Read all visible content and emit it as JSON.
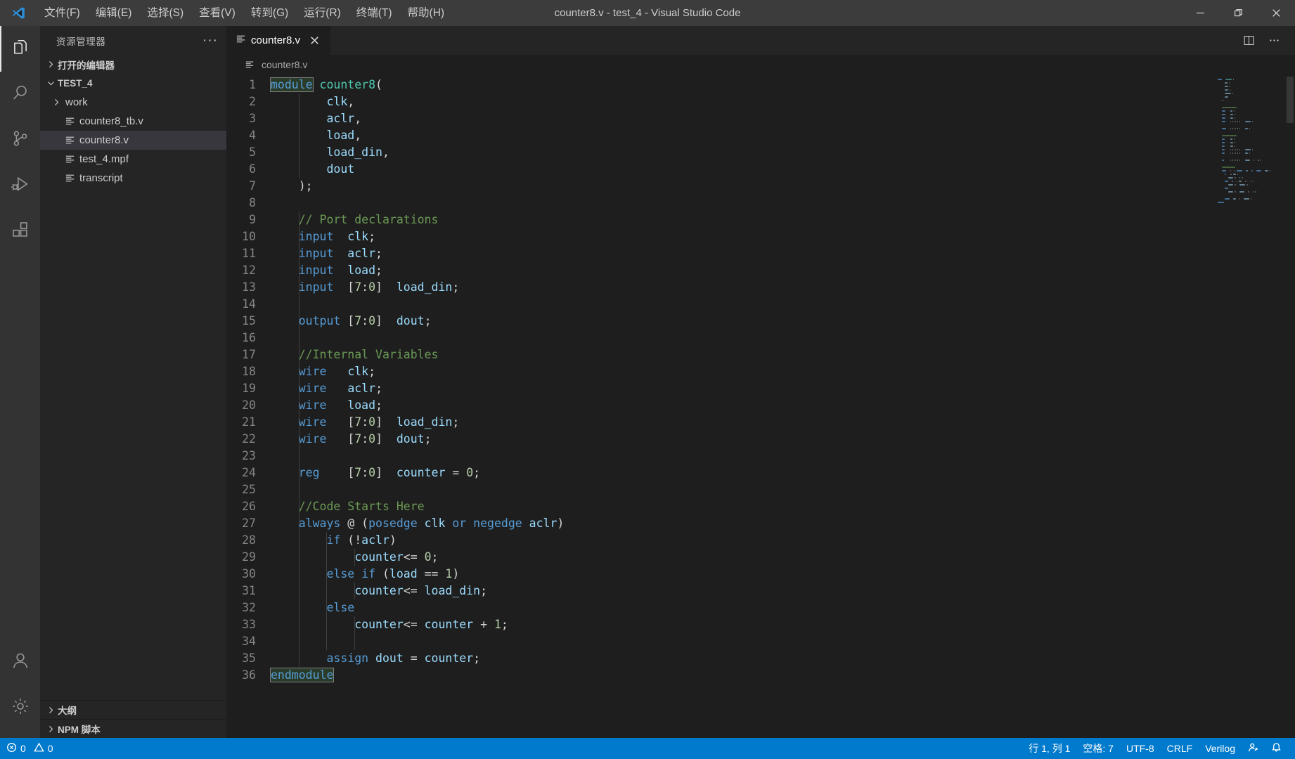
{
  "window": {
    "title": "counter8.v - test_4 - Visual Studio Code",
    "minimize_label": "minimize",
    "maximize_label": "restore",
    "close_label": "close"
  },
  "menu": [
    {
      "label": "文件(F)",
      "name": "menu-file"
    },
    {
      "label": "编辑(E)",
      "name": "menu-edit"
    },
    {
      "label": "选择(S)",
      "name": "menu-selection"
    },
    {
      "label": "查看(V)",
      "name": "menu-view"
    },
    {
      "label": "转到(G)",
      "name": "menu-go"
    },
    {
      "label": "运行(R)",
      "name": "menu-run"
    },
    {
      "label": "终端(T)",
      "name": "menu-terminal"
    },
    {
      "label": "帮助(H)",
      "name": "menu-help"
    }
  ],
  "activitybar": {
    "items": [
      {
        "icon": "files-explorer-icon",
        "name": "activity-explorer",
        "active": true
      },
      {
        "icon": "search-icon",
        "name": "activity-search",
        "active": false
      },
      {
        "icon": "source-control-icon",
        "name": "activity-source-control",
        "active": false
      },
      {
        "icon": "run-debug-icon",
        "name": "activity-run-debug",
        "active": false
      },
      {
        "icon": "extensions-icon",
        "name": "activity-extensions",
        "active": false
      }
    ],
    "bottom": [
      {
        "icon": "account-icon",
        "name": "activity-account"
      },
      {
        "icon": "gear-icon",
        "name": "activity-settings"
      }
    ]
  },
  "sidebar": {
    "title": "资源管理器",
    "more_label": "···",
    "open_editors": {
      "label": "打开的编辑器",
      "expanded": false
    },
    "folder": {
      "label": "TEST_4",
      "expanded": true
    },
    "tree": [
      {
        "label": "work",
        "type": "folder",
        "expanded": false,
        "selected": false,
        "depth": 1
      },
      {
        "label": "counter8_tb.v",
        "type": "file",
        "selected": false,
        "depth": 1
      },
      {
        "label": "counter8.v",
        "type": "file",
        "selected": true,
        "depth": 1
      },
      {
        "label": "test_4.mpf",
        "type": "file",
        "selected": false,
        "depth": 1
      },
      {
        "label": "transcript",
        "type": "file",
        "selected": false,
        "depth": 1
      }
    ],
    "bottom_panels": [
      {
        "label": "大纲",
        "name": "panel-outline"
      },
      {
        "label": "NPM 脚本",
        "name": "panel-npm-scripts"
      }
    ]
  },
  "editor": {
    "tabs": [
      {
        "label": "counter8.v",
        "active": true,
        "close_label": "×"
      }
    ],
    "actions": [
      {
        "icon": "split-editor-icon",
        "name": "split-editor-button"
      },
      {
        "icon": "more-actions-icon",
        "name": "editor-more-actions-button"
      }
    ],
    "breadcrumb": "counter8.v",
    "language": "Verilog",
    "code_lines": [
      {
        "n": 1,
        "text": "module counter8("
      },
      {
        "n": 2,
        "text": "        clk,"
      },
      {
        "n": 3,
        "text": "        aclr,"
      },
      {
        "n": 4,
        "text": "        load,"
      },
      {
        "n": 5,
        "text": "        load_din,"
      },
      {
        "n": 6,
        "text": "        dout"
      },
      {
        "n": 7,
        "text": "    );"
      },
      {
        "n": 8,
        "text": ""
      },
      {
        "n": 9,
        "text": "    // Port declarations"
      },
      {
        "n": 10,
        "text": "    input  clk;"
      },
      {
        "n": 11,
        "text": "    input  aclr;"
      },
      {
        "n": 12,
        "text": "    input  load;"
      },
      {
        "n": 13,
        "text": "    input  [7:0]  load_din;"
      },
      {
        "n": 14,
        "text": ""
      },
      {
        "n": 15,
        "text": "    output [7:0]  dout;"
      },
      {
        "n": 16,
        "text": ""
      },
      {
        "n": 17,
        "text": "    //Internal Variables"
      },
      {
        "n": 18,
        "text": "    wire   clk;"
      },
      {
        "n": 19,
        "text": "    wire   aclr;"
      },
      {
        "n": 20,
        "text": "    wire   load;"
      },
      {
        "n": 21,
        "text": "    wire   [7:0]  load_din;"
      },
      {
        "n": 22,
        "text": "    wire   [7:0]  dout;"
      },
      {
        "n": 23,
        "text": ""
      },
      {
        "n": 24,
        "text": "    reg    [7:0]  counter = 0;"
      },
      {
        "n": 25,
        "text": ""
      },
      {
        "n": 26,
        "text": "    //Code Starts Here"
      },
      {
        "n": 27,
        "text": "    always @ (posedge clk or negedge aclr)"
      },
      {
        "n": 28,
        "text": "        if (!aclr)"
      },
      {
        "n": 29,
        "text": "            counter<= 0;"
      },
      {
        "n": 30,
        "text": "        else if (load == 1)"
      },
      {
        "n": 31,
        "text": "            counter<= load_din;"
      },
      {
        "n": 32,
        "text": "        else"
      },
      {
        "n": 33,
        "text": "            counter<= counter + 1;"
      },
      {
        "n": 34,
        "text": ""
      },
      {
        "n": 35,
        "text": "        assign dout = counter;"
      },
      {
        "n": 36,
        "text": "endmodule"
      }
    ]
  },
  "statusbar": {
    "errors": "0",
    "warnings": "0",
    "cursor_position": "行 1, 列 1",
    "indentation": "空格: 7",
    "encoding": "UTF-8",
    "eol": "CRLF",
    "language": "Verilog",
    "feedback_icon": "feedback-icon",
    "bell_icon": "bell-icon"
  },
  "colors": {
    "accent": "#007acc",
    "titlebar": "#3c3c3c",
    "sidebar": "#252526",
    "editor": "#1e1e1e",
    "activitybar": "#333333",
    "selection": "#37373d"
  }
}
